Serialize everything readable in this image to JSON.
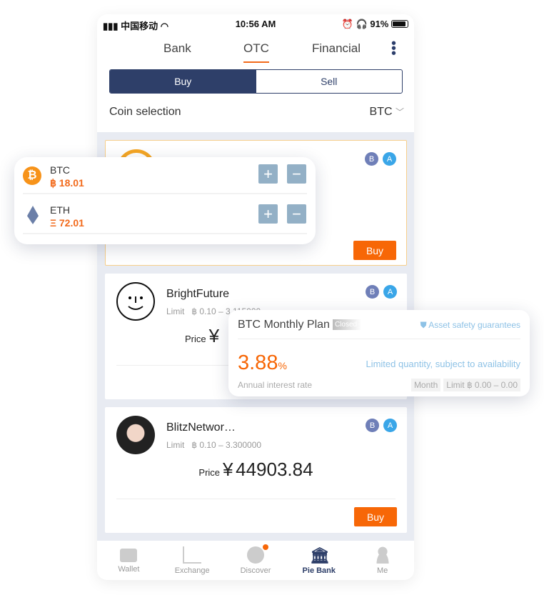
{
  "status_bar": {
    "carrier": "中国移动",
    "time": "10:56 AM",
    "battery": "91%"
  },
  "tabs": [
    {
      "label": "Bank"
    },
    {
      "label": "OTC",
      "active": true
    },
    {
      "label": "Financial"
    }
  ],
  "segment": {
    "buy": "Buy",
    "sell": "Sell",
    "selected": "Buy"
  },
  "coin_selection": {
    "label": "Coin selection",
    "value": "BTC"
  },
  "badges": {
    "b": "B",
    "a": "A"
  },
  "cards": [
    {
      "name": "",
      "buy_label": "Buy"
    },
    {
      "name": "BrightFuture",
      "limit_label": "Limit",
      "limit": "฿ 0.10 – 3.115000",
      "price_label": "Price",
      "currency": "¥"
    },
    {
      "name": "BlitzNetwor…",
      "limit_label": "Limit",
      "limit": "฿ 0.10 – 3.300000",
      "price_label": "Price",
      "currency": "¥",
      "price": "44903.84",
      "buy_label": "Buy"
    }
  ],
  "nav": [
    {
      "label": "Wallet",
      "icon": "wallet-icon"
    },
    {
      "label": "Exchange",
      "icon": "chart-icon"
    },
    {
      "label": "Discover",
      "icon": "compass-icon"
    },
    {
      "label": "Pie Bank",
      "icon": "bank-icon",
      "active": true
    },
    {
      "label": "Me",
      "icon": "user-icon"
    }
  ],
  "balances": [
    {
      "symbol": "BTC",
      "amount": "฿ 18.01",
      "icon": "bitcoin-icon"
    },
    {
      "symbol": "ETH",
      "amount": "Ξ 72.01",
      "icon": "ethereum-icon"
    }
  ],
  "plan": {
    "title": "BTC Monthly Plan",
    "status": "Closed",
    "safety": "Asset safety guarantees",
    "rate": "3.88",
    "rate_unit": "%",
    "rate_label": "Annual interest rate",
    "availability": "Limited quantity, subject to availability",
    "period": "Month",
    "limit": "Limit ฿ 0.00 – 0.00"
  },
  "colors": {
    "primary": "#2e3f69",
    "accent": "#f76707",
    "badge_b": "#6f7fb8",
    "badge_a": "#3aa6e8"
  }
}
